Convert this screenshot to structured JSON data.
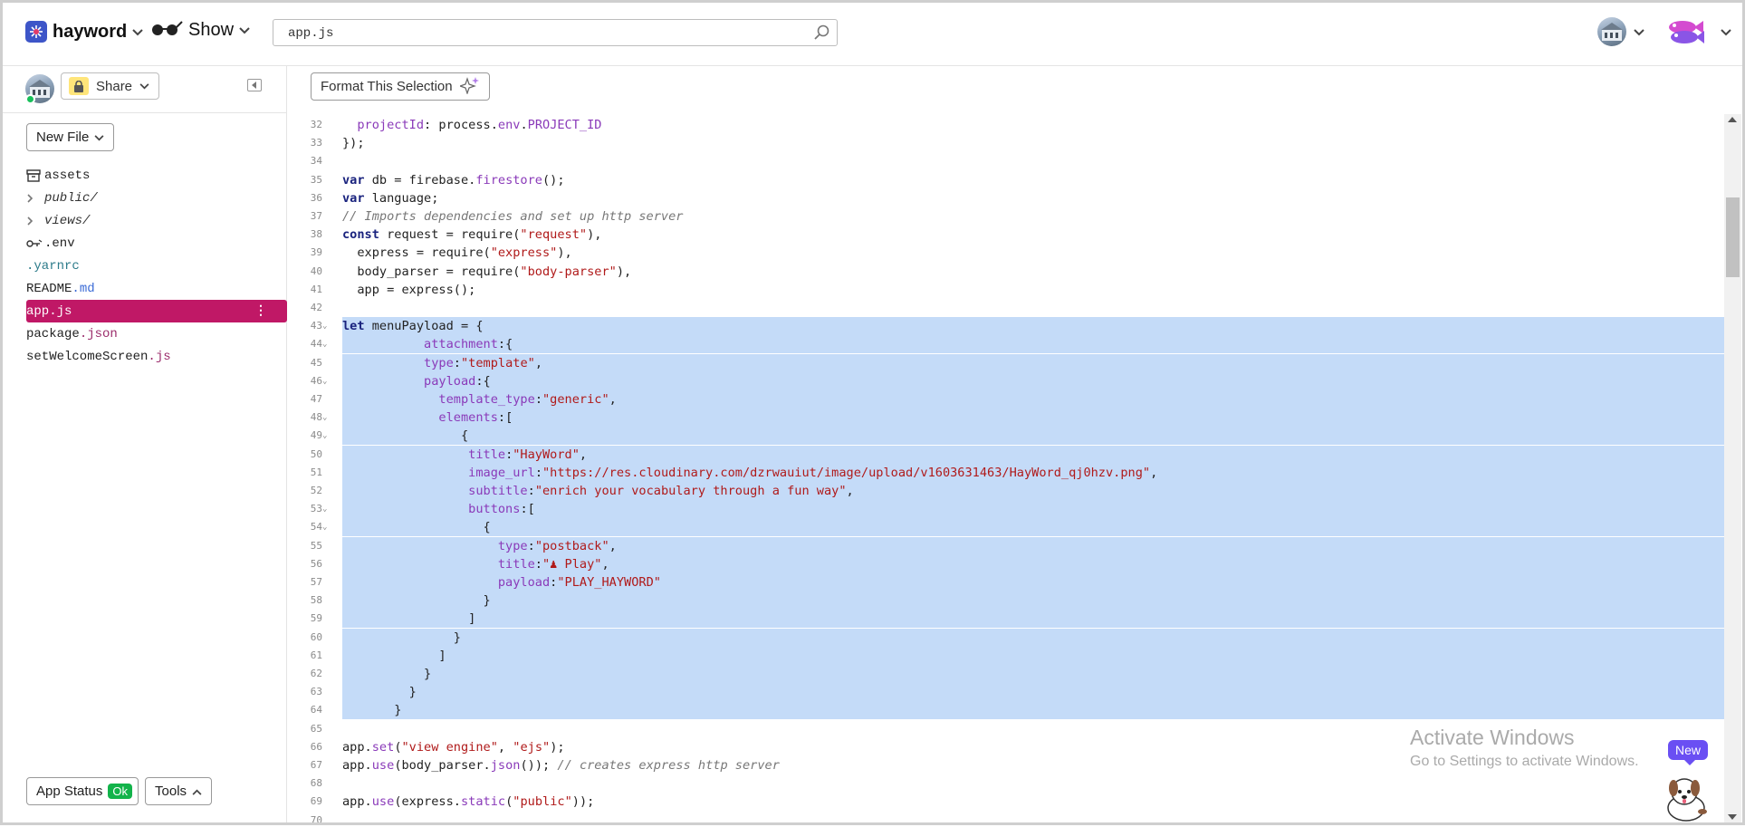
{
  "topbar": {
    "project_name": "hayword",
    "show_label": "Show",
    "search_value": "app.js"
  },
  "sidebar": {
    "share_label": "Share",
    "new_file_label": "New File",
    "files": [
      {
        "name": "assets",
        "ext": "",
        "type": "assets"
      },
      {
        "name": "public/",
        "ext": "",
        "type": "folder"
      },
      {
        "name": "views/",
        "ext": "",
        "type": "folder"
      },
      {
        "name": ".env",
        "ext": "",
        "type": "env"
      },
      {
        "name": ".yarnrc",
        "ext": "",
        "type": "file"
      },
      {
        "name": "README",
        "ext": ".md",
        "type": "file"
      },
      {
        "name": "app",
        "ext": ".js",
        "type": "file",
        "active": true
      },
      {
        "name": "package",
        "ext": ".json",
        "type": "file"
      },
      {
        "name": "setWelcomeScreen",
        "ext": ".js",
        "type": "file"
      }
    ],
    "app_status_label": "App Status",
    "app_status_badge": "Ok",
    "tools_label": "Tools"
  },
  "editor": {
    "format_button_label": "Format This Selection",
    "lines": [
      {
        "n": "32",
        "fold": false,
        "sel": false,
        "html": "  <span class='prop'>projectId</span>: process.<span class='prop'>env</span>.<span class='prop'>PROJECT_ID</span>"
      },
      {
        "n": "33",
        "fold": false,
        "sel": false,
        "html": "});"
      },
      {
        "n": "34",
        "fold": false,
        "sel": false,
        "html": ""
      },
      {
        "n": "35",
        "fold": false,
        "sel": false,
        "html": "<span class='kw'>var</span> db = firebase.<span class='prop'>firestore</span>();"
      },
      {
        "n": "36",
        "fold": false,
        "sel": false,
        "html": "<span class='kw'>var</span> language;"
      },
      {
        "n": "37",
        "fold": false,
        "sel": false,
        "html": "<span class='cmt'>// Imports dependencies and set up http server</span>"
      },
      {
        "n": "38",
        "fold": false,
        "sel": false,
        "html": "<span class='kw'>const</span> request = require(<span class='str'>\"request\"</span>),"
      },
      {
        "n": "39",
        "fold": false,
        "sel": false,
        "html": "  express = require(<span class='str'>\"express\"</span>),"
      },
      {
        "n": "40",
        "fold": false,
        "sel": false,
        "html": "  body_parser = require(<span class='str'>\"body-parser\"</span>),"
      },
      {
        "n": "41",
        "fold": false,
        "sel": false,
        "html": "  app = express();"
      },
      {
        "n": "42",
        "fold": false,
        "sel": false,
        "html": ""
      },
      {
        "n": "43",
        "fold": true,
        "sel": true,
        "html": "<span class='kw'>let</span> menuPayload = {"
      },
      {
        "n": "44",
        "fold": true,
        "sel": true,
        "html": "           <span class='prop'>attachment</span>:{"
      },
      {
        "n": "45",
        "fold": false,
        "sel": true,
        "html": "           <span class='prop'>type</span>:<span class='str'>\"template\"</span>,"
      },
      {
        "n": "46",
        "fold": true,
        "sel": true,
        "html": "           <span class='prop'>payload</span>:{"
      },
      {
        "n": "47",
        "fold": false,
        "sel": true,
        "html": "             <span class='prop'>template_type</span>:<span class='str'>\"generic\"</span>,"
      },
      {
        "n": "48",
        "fold": true,
        "sel": true,
        "html": "             <span class='prop'>elements</span>:["
      },
      {
        "n": "49",
        "fold": true,
        "sel": true,
        "html": "                {"
      },
      {
        "n": "50",
        "fold": false,
        "sel": true,
        "html": "                 <span class='prop'>title</span>:<span class='str'>\"HayWord\"</span>,"
      },
      {
        "n": "51",
        "fold": false,
        "sel": true,
        "html": "                 <span class='prop'>image_url</span>:<span class='str'>\"https://res.cloudinary.com/dzrwauiut/image/upload/v1603631463/HayWord_qj0hzv.png\"</span>,"
      },
      {
        "n": "52",
        "fold": false,
        "sel": true,
        "html": "                 <span class='prop'>subtitle</span>:<span class='str'>\"enrich your vocabulary through a fun way\"</span>,"
      },
      {
        "n": "53",
        "fold": true,
        "sel": true,
        "html": "                 <span class='prop'>buttons</span>:["
      },
      {
        "n": "54",
        "fold": true,
        "sel": true,
        "html": "                   {"
      },
      {
        "n": "55",
        "fold": false,
        "sel": true,
        "html": "                     <span class='prop'>type</span>:<span class='str'>\"postback\"</span>,"
      },
      {
        "n": "56",
        "fold": false,
        "sel": true,
        "html": "                     <span class='prop'>title</span>:<span class='str'>\"♟ Play\"</span>,"
      },
      {
        "n": "57",
        "fold": false,
        "sel": true,
        "html": "                     <span class='prop'>payload</span>:<span class='str'>\"PLAY_HAYWORD\"</span>"
      },
      {
        "n": "58",
        "fold": false,
        "sel": true,
        "html": "                   }"
      },
      {
        "n": "59",
        "fold": false,
        "sel": true,
        "html": "                 ]"
      },
      {
        "n": "60",
        "fold": false,
        "sel": true,
        "html": "               }"
      },
      {
        "n": "61",
        "fold": false,
        "sel": true,
        "html": "             ]"
      },
      {
        "n": "62",
        "fold": false,
        "sel": true,
        "html": "           }"
      },
      {
        "n": "63",
        "fold": false,
        "sel": true,
        "html": "         }"
      },
      {
        "n": "64",
        "fold": false,
        "sel": true,
        "html": "       }"
      },
      {
        "n": "65",
        "fold": false,
        "sel": false,
        "html": ""
      },
      {
        "n": "66",
        "fold": false,
        "sel": false,
        "html": "app.<span class='prop'>set</span>(<span class='str'>\"view engine\"</span>, <span class='str'>\"ejs\"</span>);"
      },
      {
        "n": "67",
        "fold": false,
        "sel": false,
        "html": "app.<span class='prop'>use</span>(body_parser.<span class='prop'>json</span>()); <span class='cmt'>// creates express http server</span>"
      },
      {
        "n": "68",
        "fold": false,
        "sel": false,
        "html": ""
      },
      {
        "n": "69",
        "fold": false,
        "sel": false,
        "html": "app.<span class='prop'>use</span>(express.<span class='prop'>static</span>(<span class='str'>\"public\"</span>));"
      },
      {
        "n": "70",
        "fold": false,
        "sel": false,
        "html": ""
      }
    ]
  },
  "watermark": {
    "title": "Activate Windows",
    "subtitle": "Go to Settings to activate Windows."
  },
  "new_badge": "New",
  "colors": {
    "accent_active": "#c01866",
    "selection": "#c4dbf8",
    "ok_green": "#12b34a",
    "new_badge": "#6a4ff3"
  }
}
